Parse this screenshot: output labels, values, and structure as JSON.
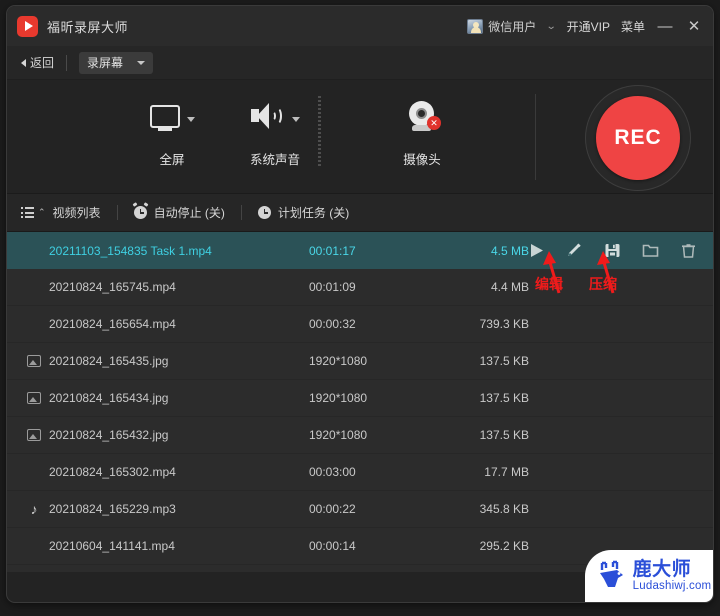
{
  "titlebar": {
    "app_name": "福昕录屏大师",
    "logo_icon": "app-play-logo-icon",
    "user_name": "微信用户",
    "user_caret": "⌄",
    "vip_label": "开通VIP",
    "menu_label": "菜单",
    "minimize_label": "—",
    "close_label": "✕",
    "accent_red": "#e8392e"
  },
  "navbar": {
    "back_label": "返回",
    "mode_label": "录屏幕"
  },
  "sources": [
    {
      "label": "全屏",
      "icon": "monitor-icon",
      "has_caret": true
    },
    {
      "label": "系统声音",
      "icon": "speaker-icon",
      "has_caret": true
    },
    {
      "label": "摄像头",
      "icon": "webcam-disabled-icon",
      "has_caret": false
    }
  ],
  "record": {
    "button_label": "REC",
    "color": "#ef4444"
  },
  "tabs": [
    {
      "label": "视频列表",
      "icon": "list-icon"
    },
    {
      "label": "自动停止 (关)",
      "icon": "alarm-clock-icon"
    },
    {
      "label": "计划任务 (关)",
      "icon": "clock-icon"
    }
  ],
  "filelist": {
    "rows": [
      {
        "name": "20211103_154835 Task 1.mp4",
        "duration": "00:01:17",
        "size": "4.5 MB",
        "icon": "none",
        "selected": true
      },
      {
        "name": "20210824_165745.mp4",
        "duration": "00:01:09",
        "size": "4.4 MB",
        "icon": "none",
        "selected": false
      },
      {
        "name": "20210824_165654.mp4",
        "duration": "00:00:32",
        "size": "739.3 KB",
        "icon": "none",
        "selected": false
      },
      {
        "name": "20210824_165435.jpg",
        "duration": "1920*1080",
        "size": "137.5 KB",
        "icon": "image",
        "selected": false
      },
      {
        "name": "20210824_165434.jpg",
        "duration": "1920*1080",
        "size": "137.5 KB",
        "icon": "image",
        "selected": false
      },
      {
        "name": "20210824_165432.jpg",
        "duration": "1920*1080",
        "size": "137.5 KB",
        "icon": "image",
        "selected": false
      },
      {
        "name": "20210824_165302.mp4",
        "duration": "00:03:00",
        "size": "17.7 MB",
        "icon": "none",
        "selected": false
      },
      {
        "name": "20210824_165229.mp3",
        "duration": "00:00:22",
        "size": "345.8 KB",
        "icon": "music",
        "selected": false
      },
      {
        "name": "20210604_141141.mp4",
        "duration": "00:00:14",
        "size": "295.2 KB",
        "icon": "none",
        "selected": false
      }
    ],
    "actions": [
      {
        "icon": "play-icon"
      },
      {
        "icon": "edit-icon"
      },
      {
        "icon": "compress-icon"
      },
      {
        "icon": "folder-icon"
      },
      {
        "icon": "trash-icon"
      }
    ],
    "selected_row_bg": "#2b5257"
  },
  "annotations": {
    "color": "#f01b1b",
    "edit_label": "编辑",
    "compress_label": "压缩"
  },
  "watermark": {
    "logo_icon": "deer-logo-icon",
    "cn": "鹿大师",
    "en": "Ludashiwj.com",
    "color": "#2b4fd8"
  }
}
